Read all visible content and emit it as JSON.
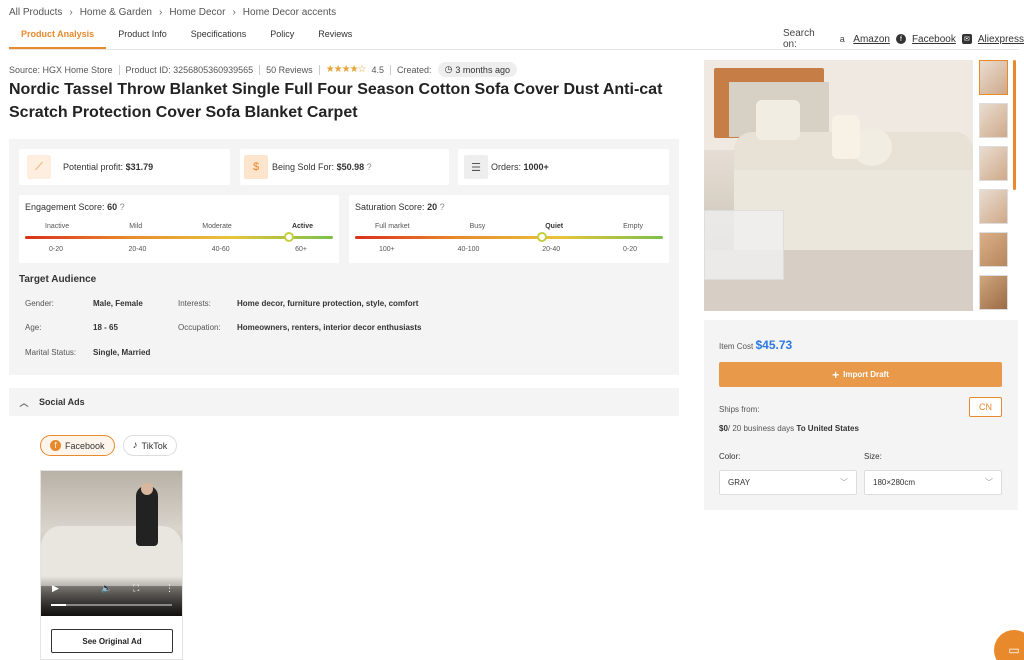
{
  "breadcrumb": [
    "All Products",
    "Home & Garden",
    "Home Decor",
    "Home Decor accents"
  ],
  "tabs": [
    "Product Analysis",
    "Product Info",
    "Specifications",
    "Policy",
    "Reviews"
  ],
  "search_on": {
    "label": "Search on:",
    "links": [
      "Amazon",
      "Facebook",
      "Aliexpress"
    ]
  },
  "meta": {
    "source": "Source: HGX Home Store",
    "product_id": "Product ID: 3256805360939565",
    "reviews": "50 Reviews",
    "rating": "4.5",
    "created_label": "Created:",
    "created_value": "3 months ago"
  },
  "title": "Nordic Tassel Throw Blanket Single Full Four Season Cotton Sofa Cover Dust Anti-cat Scratch Protection Cover Sofa Blanket Carpet",
  "stats": {
    "profit_label": "Potential profit:",
    "profit_value": "$31.79",
    "sold_label": "Being Sold For:",
    "sold_value": "$50.98",
    "orders_label": "Orders:",
    "orders_value": "1000+"
  },
  "engagement": {
    "label": "Engagement Score:",
    "value": "60",
    "levels": [
      "Inactive",
      "Mild",
      "Moderate",
      "Active"
    ],
    "ranges": [
      "0-20",
      "20-40",
      "40-60",
      "60+"
    ],
    "active_level": "Active"
  },
  "saturation": {
    "label": "Saturation Score:",
    "value": "20",
    "levels": [
      "Full market",
      "Busy",
      "Quiet",
      "Empty"
    ],
    "ranges": [
      "100+",
      "40-100",
      "20-40",
      "0-20"
    ],
    "active_level": "Quiet"
  },
  "audience": {
    "title": "Target Audience",
    "gender_label": "Gender:",
    "gender": "Male, Female",
    "interests_label": "Interests:",
    "interests": "Home decor, furniture protection, style, comfort",
    "age_label": "Age:",
    "age": "18 - 65",
    "occupation_label": "Occupation:",
    "occupation": "Homeowners, renters, interior decor enthusiasts",
    "marital_label": "Marital Status:",
    "marital": "Single, Married"
  },
  "social": {
    "title": "Social Ads",
    "platforms": [
      "Facebook",
      "TikTok"
    ],
    "active_platform": "Facebook",
    "see_original": "See Original Ad"
  },
  "buy": {
    "cost_label": "Item Cost",
    "cost_value": "$45.73",
    "import_label": "Import Draft",
    "ships_label": "Ships from:",
    "ship_origin": "CN",
    "shipping_price": "$0",
    "shipping_days": "/ 20 business days",
    "shipping_dest": "To United States",
    "color_label": "Color:",
    "color_value": "GRAY",
    "size_label": "Size:",
    "size_value": "180×280cm"
  },
  "colors": {
    "accent": "#e8892c",
    "link": "#2b78e4"
  }
}
